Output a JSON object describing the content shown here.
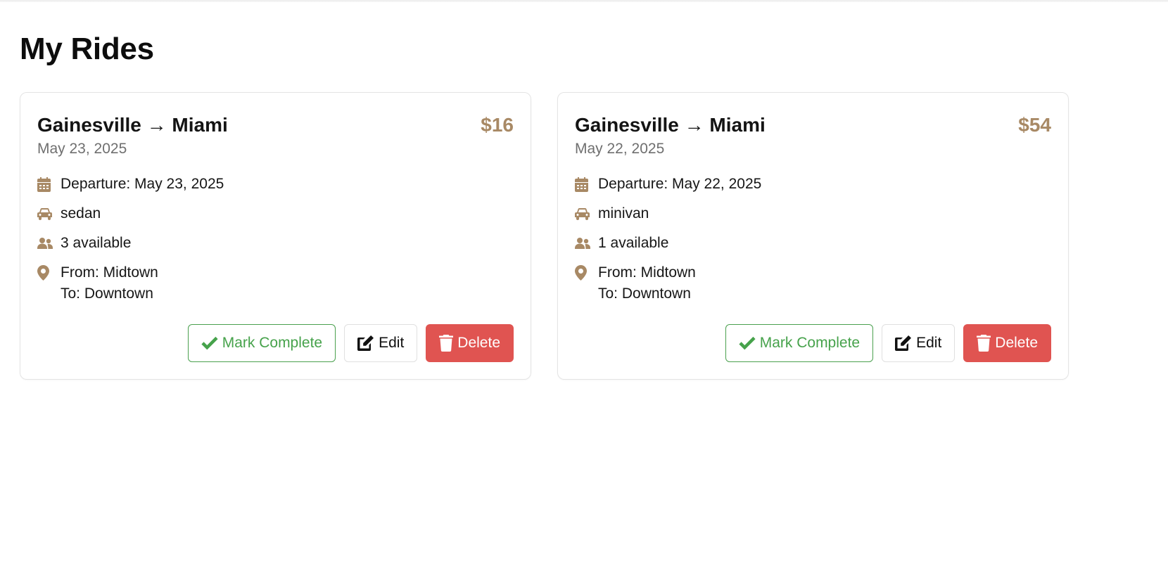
{
  "page": {
    "title": "My Rides"
  },
  "colors": {
    "accent": "#a88965",
    "complete": "#46a24b",
    "delete": "#e05451"
  },
  "rides": [
    {
      "route": "Gainesville → Miami",
      "price": "$16",
      "date": "May 23, 2025",
      "departure": "Departure: May 23, 2025",
      "vehicle": "sedan",
      "seats": "3 available",
      "from": "From: Midtown",
      "to": "To: Downtown",
      "actions": {
        "complete": "Mark Complete",
        "edit": "Edit",
        "delete": "Delete"
      }
    },
    {
      "route": "Gainesville → Miami",
      "price": "$54",
      "date": "May 22, 2025",
      "departure": "Departure: May 22, 2025",
      "vehicle": "minivan",
      "seats": "1 available",
      "from": "From: Midtown",
      "to": "To: Downtown",
      "actions": {
        "complete": "Mark Complete",
        "edit": "Edit",
        "delete": "Delete"
      }
    }
  ]
}
